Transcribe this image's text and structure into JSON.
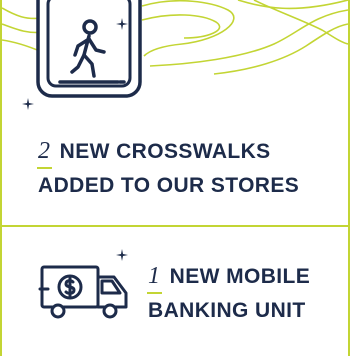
{
  "colors": {
    "navy": "#1d2b4a",
    "lime": "#c3d534"
  },
  "stats": [
    {
      "number": "2",
      "line1": "NEW CROSSWALKS",
      "line2": "ADDED TO OUR STORES",
      "icon": "crosswalk-sign-icon"
    },
    {
      "number": "1",
      "line1": "NEW MOBILE",
      "line2": "BANKING UNIT",
      "icon": "mobile-banking-truck-icon"
    }
  ]
}
